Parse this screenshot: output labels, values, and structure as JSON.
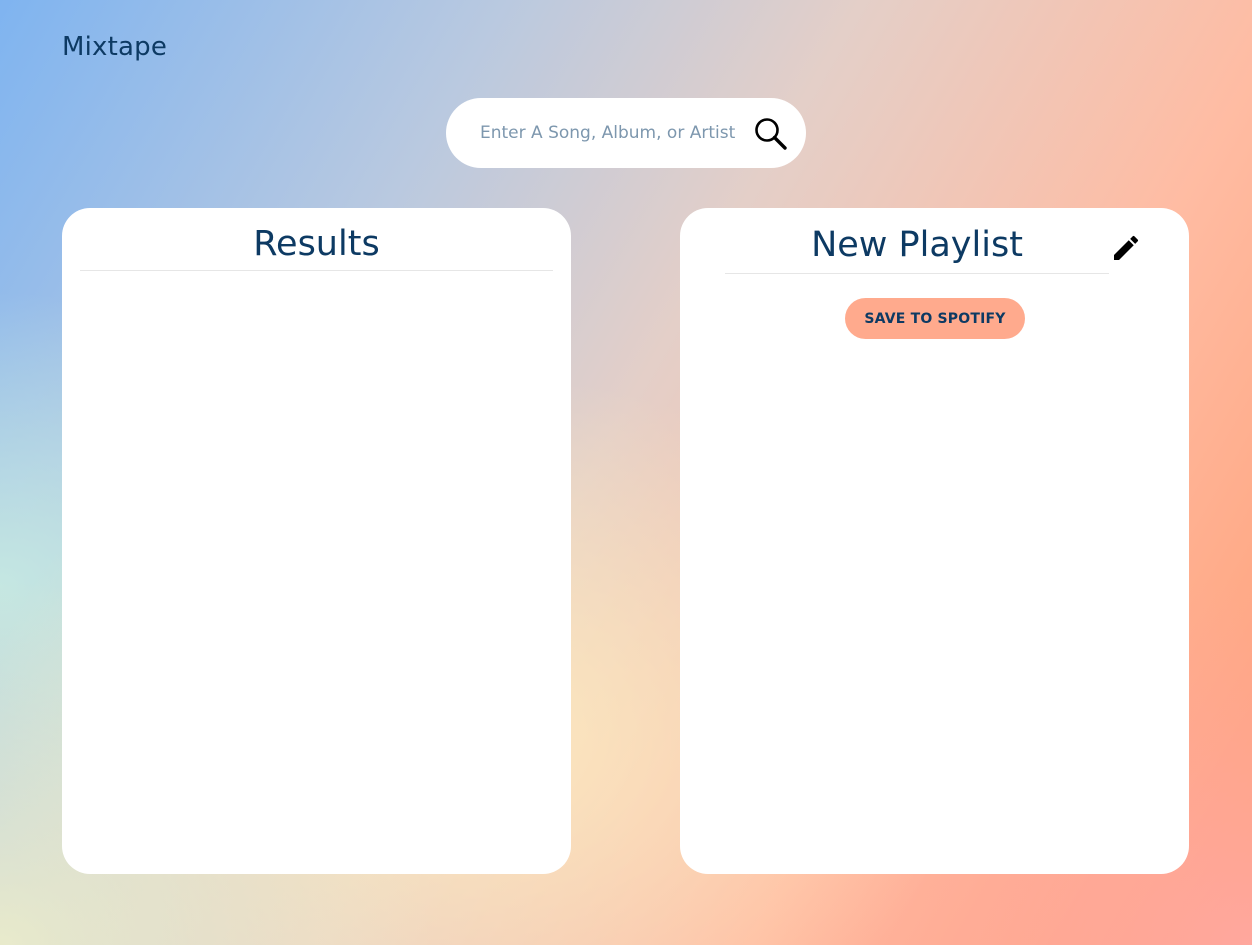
{
  "app": {
    "logo_text": "Mixtape"
  },
  "search": {
    "placeholder": "Enter A Song, Album, or Artist",
    "value": "",
    "button_icon": "search-icon"
  },
  "results": {
    "title": "Results",
    "tracks": []
  },
  "playlist": {
    "name": "New Playlist",
    "edit_icon": "pencil-icon",
    "save_label": "SAVE TO SPOTIFY",
    "tracks": []
  },
  "colors": {
    "primary_text": "#0d3a63",
    "button_bg": "#ffaa8d",
    "panel_bg": "#ffffff"
  }
}
